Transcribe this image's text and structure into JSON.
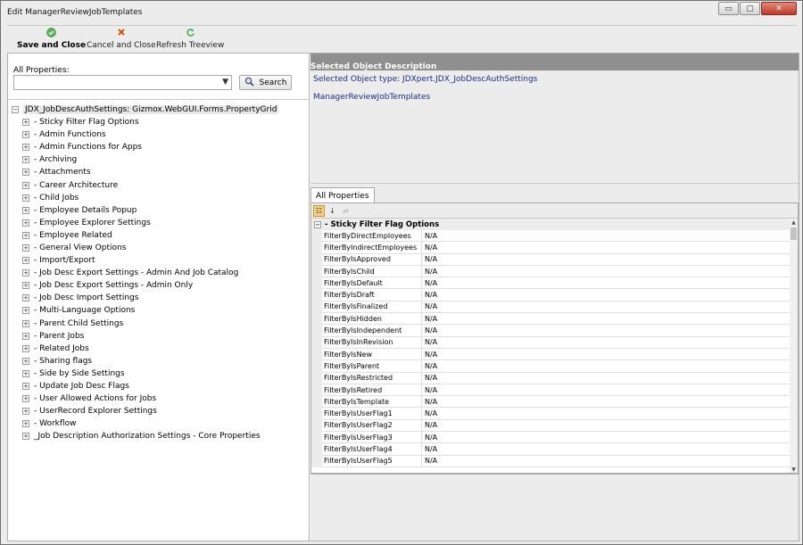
{
  "window": {
    "title": "Edit ManagerReviewJobTemplates",
    "min_glyph": "▭",
    "max_glyph": "▢",
    "close_glyph": "✕"
  },
  "toolbar": {
    "save_close_label": "Save and Close",
    "save_close_icon": "check-circle-icon",
    "cancel_close_label": "Cancel and Close",
    "cancel_close_icon": "x-icon",
    "refresh_label": "Refresh Treeview",
    "refresh_icon": "refresh-icon"
  },
  "left_panel": {
    "all_properties_label": "All Properties:",
    "combo_value": "",
    "search_label": "Search"
  },
  "tree": {
    "root": "JDX_JobDescAuthSettings: Gizmox.WebGUI.Forms.PropertyGrid",
    "items": [
      " - Sticky Filter Flag Options",
      "- Admin Functions",
      "- Admin Functions for Apps",
      "- Archiving",
      "- Attachments",
      "- Career Architecture",
      "- Child Jobs",
      "- Employee Details Popup",
      "- Employee Explorer Settings",
      "- Employee Related",
      "- General View Options",
      "- Import/Export",
      "- Job Desc Export Settings - Admin And Job Catalog",
      "- Job Desc Export Settings - Admin Only",
      "- Job Desc Import Settings",
      "- Multi-Language Options",
      "- Parent Child Settings",
      "- Parent Jobs",
      "- Related Jobs",
      "- Sharing flags",
      "- Side by Side Settings",
      "- Update Job Desc Flags",
      "- User Allowed Actions for Jobs",
      "- UserRecord Explorer Settings",
      "- Workflow",
      "_Job Description Authorization Settings - Core Properties"
    ]
  },
  "description": {
    "header": "Selected Object Description",
    "object_type": "Selected Object type: JDXpert.JDX_JobDescAuthSettings",
    "object_name": "ManagerReviewJobTemplates"
  },
  "property_grid": {
    "tab_label": "All Properties",
    "category": "- Sticky Filter Flag Options",
    "rows": [
      {
        "name": "FilterByDirectEmployees",
        "value": "N/A"
      },
      {
        "name": "FilterByIndirectEmployees",
        "value": "N/A"
      },
      {
        "name": "FilterByIsApproved",
        "value": "N/A"
      },
      {
        "name": "FilterByIsChild",
        "value": "N/A"
      },
      {
        "name": "FilterByIsDefault",
        "value": "N/A"
      },
      {
        "name": "FilterByIsDraft",
        "value": "N/A"
      },
      {
        "name": "FilterByIsFinalized",
        "value": "N/A"
      },
      {
        "name": "FilterByIsHidden",
        "value": "N/A"
      },
      {
        "name": "FilterByIsIndependent",
        "value": "N/A"
      },
      {
        "name": "FilterByIsInRevision",
        "value": "N/A"
      },
      {
        "name": "FilterByIsNew",
        "value": "N/A"
      },
      {
        "name": "FilterByIsParent",
        "value": "N/A"
      },
      {
        "name": "FilterByIsRestricted",
        "value": "N/A"
      },
      {
        "name": "FilterByIsRetired",
        "value": "N/A"
      },
      {
        "name": "FilterByIsTemplate",
        "value": "N/A"
      },
      {
        "name": "FilterByIsUserFlag1",
        "value": "N/A"
      },
      {
        "name": "FilterByIsUserFlag2",
        "value": "N/A"
      },
      {
        "name": "FilterByIsUserFlag3",
        "value": "N/A"
      },
      {
        "name": "FilterByIsUserFlag4",
        "value": "N/A"
      },
      {
        "name": "FilterByIsUserFlag5",
        "value": "N/A"
      }
    ]
  },
  "colors": {
    "desc_header_bg": "#8f8f8f",
    "desc_text": "#1a2d8c",
    "window_bg": "#ececec"
  }
}
